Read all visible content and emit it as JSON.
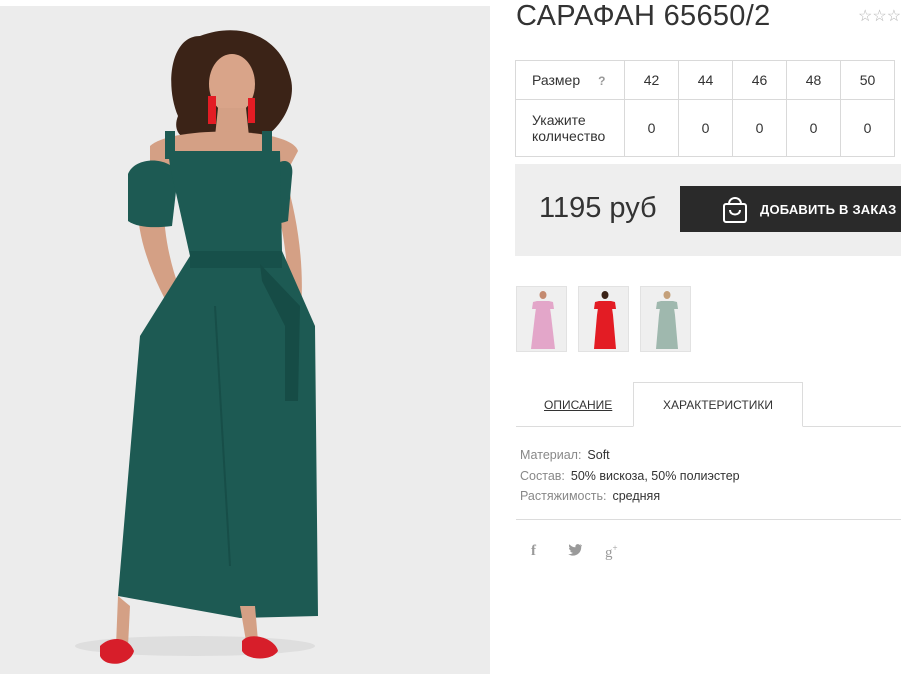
{
  "product": {
    "title": "САРАФАН 65650/2",
    "rating_stars": "☆☆☆☆☆"
  },
  "sizes": {
    "size_label": "Размер",
    "help_icon": "?",
    "qty_label_line1": "Укажите",
    "qty_label_line2": "количество",
    "columns": [
      "42",
      "44",
      "46",
      "48",
      "50"
    ],
    "quantities": [
      "0",
      "0",
      "0",
      "0",
      "0"
    ]
  },
  "buy": {
    "price": "1195 руб",
    "add_label": "ДОБАВИТЬ В ЗАКАЗ",
    "button_icon": "shopping-bag-icon"
  },
  "thumbnails": [
    {
      "color": "#e3a6c9"
    },
    {
      "color": "#e31c24"
    },
    {
      "color": "#9fb8ae"
    }
  ],
  "tabs": {
    "description": "ОПИСАНИЕ",
    "characteristics": "ХАРАКТЕРИСТИКИ"
  },
  "specs": [
    {
      "key": "Материал:",
      "value": "Soft"
    },
    {
      "key": "Состав:",
      "value": "50% вискоза, 50% полиэстер"
    },
    {
      "key": "Растяжимость:",
      "value": "средняя"
    }
  ],
  "social": {
    "facebook": "f",
    "twitter": "🐦",
    "google": "g+"
  },
  "colors": {
    "dress": "#1d5a53",
    "accent_red": "#d71e2a",
    "button_bg": "#2a2a2a",
    "buybox_bg": "#eeeeee"
  }
}
